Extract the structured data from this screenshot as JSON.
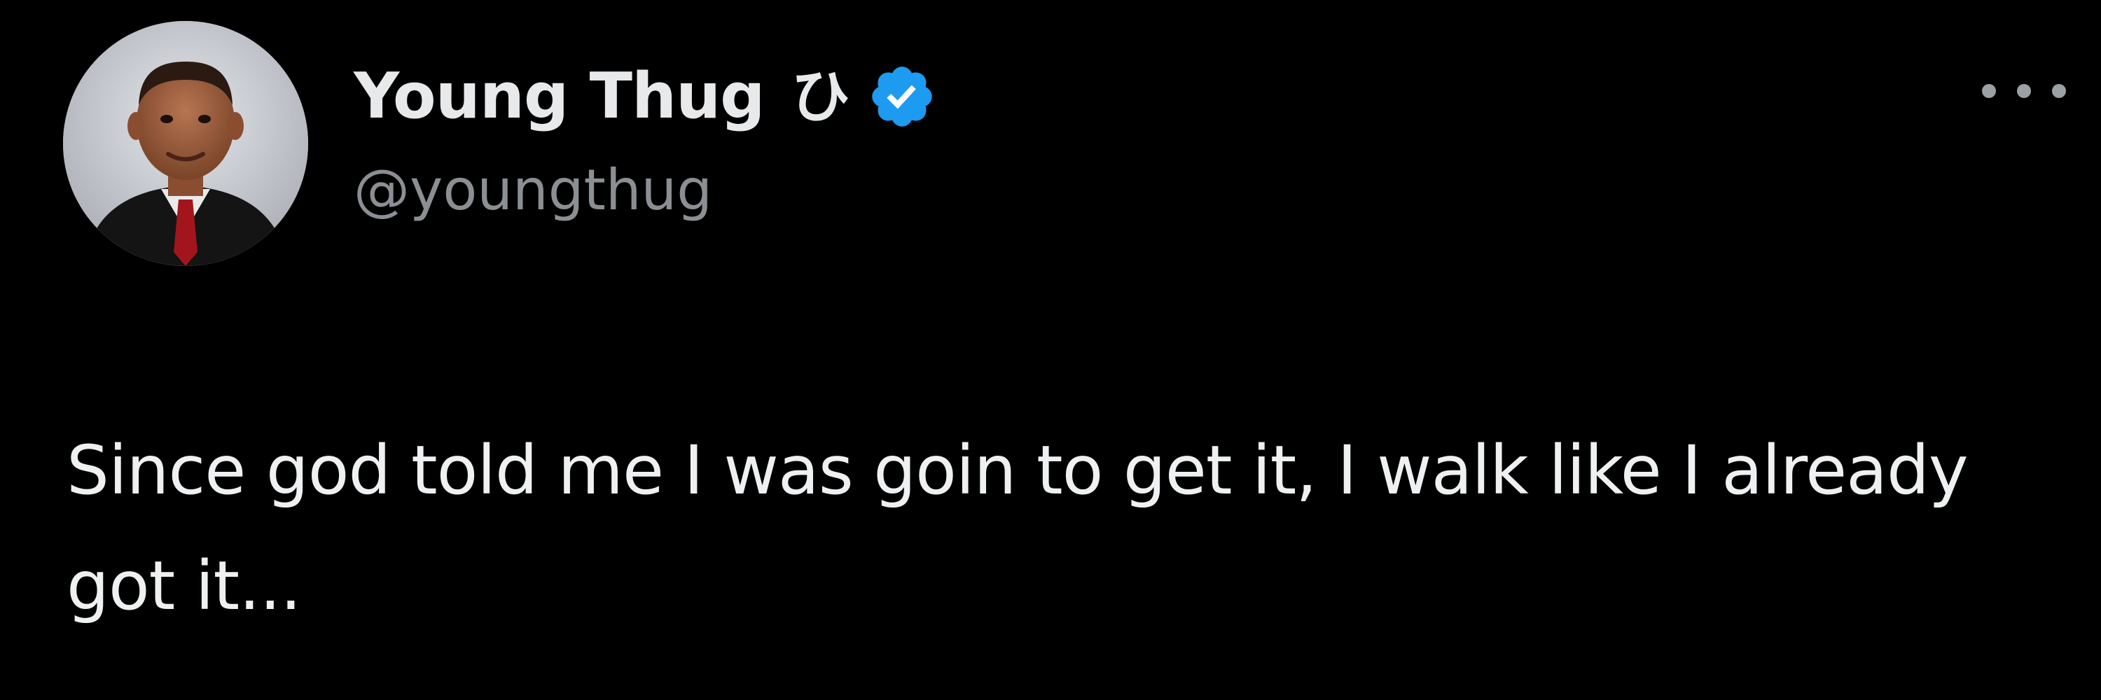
{
  "tweet": {
    "author": {
      "display_name": "Young Thug",
      "name_glyph": "ひ",
      "handle": "@youngthug",
      "verified": true,
      "avatar_icon": "avatar-photo-icon"
    },
    "more_icon": "more-horizontal-icon",
    "text": "Since god told me I was goin to get it, I walk like I already got it..."
  },
  "colors": {
    "background": "#000000",
    "text": "#e7e9ea",
    "handle": "#8b8f94",
    "verified_badge": "#1d9bf0"
  }
}
